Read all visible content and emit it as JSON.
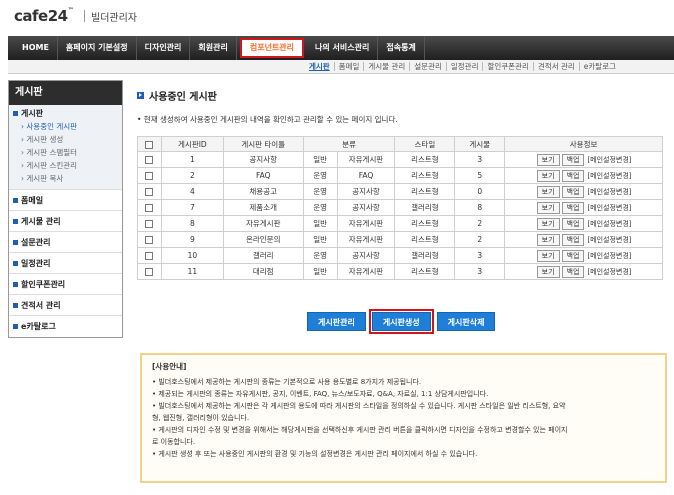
{
  "header": {
    "logo": "cafe24",
    "logo_tm": "™",
    "sub": "빌더관리자"
  },
  "mainnav": [
    {
      "label": "HOME",
      "active": false
    },
    {
      "label": "홈페이지 기본설정",
      "active": false
    },
    {
      "label": "디자인관리",
      "active": false
    },
    {
      "label": "회원관리",
      "active": false
    },
    {
      "label": "컴포넌트관리",
      "active": true
    },
    {
      "label": "나의 서비스관리",
      "active": false
    },
    {
      "label": "접속통계",
      "active": false
    }
  ],
  "subnav": [
    {
      "label": "게시판",
      "active": true
    },
    {
      "label": "폼메일",
      "active": false
    },
    {
      "label": "게시물 관리",
      "active": false
    },
    {
      "label": "설문관리",
      "active": false
    },
    {
      "label": "일정관리",
      "active": false
    },
    {
      "label": "할인쿠폰관리",
      "active": false
    },
    {
      "label": "견적서 관리",
      "active": false
    },
    {
      "label": "e카탈로그",
      "active": false
    }
  ],
  "sidebar": {
    "title": "게시판",
    "group0": {
      "title": "게시판",
      "items": [
        "사용중인 게시판",
        "게시판 생성",
        "게시판 스팸필터",
        "게시판 스킨관리",
        "게시판 복사"
      ]
    },
    "groups": [
      "폼메일",
      "게시물 관리",
      "설문관리",
      "일정관리",
      "할인쿠폰관리",
      "견적서 관리",
      "e카탈로그"
    ]
  },
  "content": {
    "title": "사용중인 게시판",
    "desc": "• 현재 생성하여 사용중인 게시판의 내역을 확인하고 관리할 수 있는 페이지 입니다."
  },
  "table": {
    "headers": [
      "게시판ID",
      "게시판 타이틀",
      "분류",
      "스타일",
      "게시물",
      "사용정보"
    ],
    "rows": [
      {
        "id": "1",
        "title": "공지사항",
        "type": "일반",
        "cat": "자유게시판",
        "style": "리스트형",
        "count": "3"
      },
      {
        "id": "2",
        "title": "FAQ",
        "type": "운영",
        "cat": "FAQ",
        "style": "리스트형",
        "count": "5"
      },
      {
        "id": "4",
        "title": "채용공고",
        "type": "운영",
        "cat": "공지사항",
        "style": "리스트형",
        "count": "0"
      },
      {
        "id": "7",
        "title": "제품소개",
        "type": "운영",
        "cat": "공지사항",
        "style": "갤러리형",
        "count": "8"
      },
      {
        "id": "8",
        "title": "자유게시판",
        "type": "일반",
        "cat": "자유게시판",
        "style": "리스트형",
        "count": "2"
      },
      {
        "id": "9",
        "title": "온라인문의",
        "type": "일반",
        "cat": "자유게시판",
        "style": "리스트형",
        "count": "2"
      },
      {
        "id": "10",
        "title": "갤러리",
        "type": "운영",
        "cat": "공지사항",
        "style": "갤러리형",
        "count": "3"
      },
      {
        "id": "11",
        "title": "대리점",
        "type": "일반",
        "cat": "자유게시판",
        "style": "리스트형",
        "count": "3"
      }
    ],
    "btn_view": "보기",
    "btn_backup": "백업",
    "main_setting": "[메인설정변경]"
  },
  "actions": {
    "manage": "게시판관리",
    "create": "게시판생성",
    "delete": "게시판삭제"
  },
  "info": {
    "title": "[사용안내]",
    "lines": [
      "• 빌더호스팅에서 제공하는 게시판의 종류는 기본적으로 사용 용도별로 8가지가 제공됩니다.",
      "• 제공되는 게시판의 종류는 자유게시판, 공지, 이벤트, FAQ, 뉴스/보도자료, Q&A, 자료실, 1:1 상담게시판입니다.",
      "• 빌더호스팅에서 제공하는 게시판은 각 게시판의 용도에 따라 게시판의 스타일을 정의하실 수 있습니다. 게시판 스타일은 일반 리스트형, 요약",
      "  형, 웹진형, 갤러리형이 있습니다.",
      "• 게시판의 디자인 수정 및 변경을 위해서는 해당게시판을 선택하신후 게시판 관리 버튼을 클릭하시면 디자인을 수정하고 변경할수 있는 페이지",
      "  로 이동합니다.",
      "• 게시판 생성 후 또는 사용중인 게시판의 환경 및 기능의 설정변경은 게시판 관리 페이지에서 하실 수 있습니다."
    ]
  }
}
